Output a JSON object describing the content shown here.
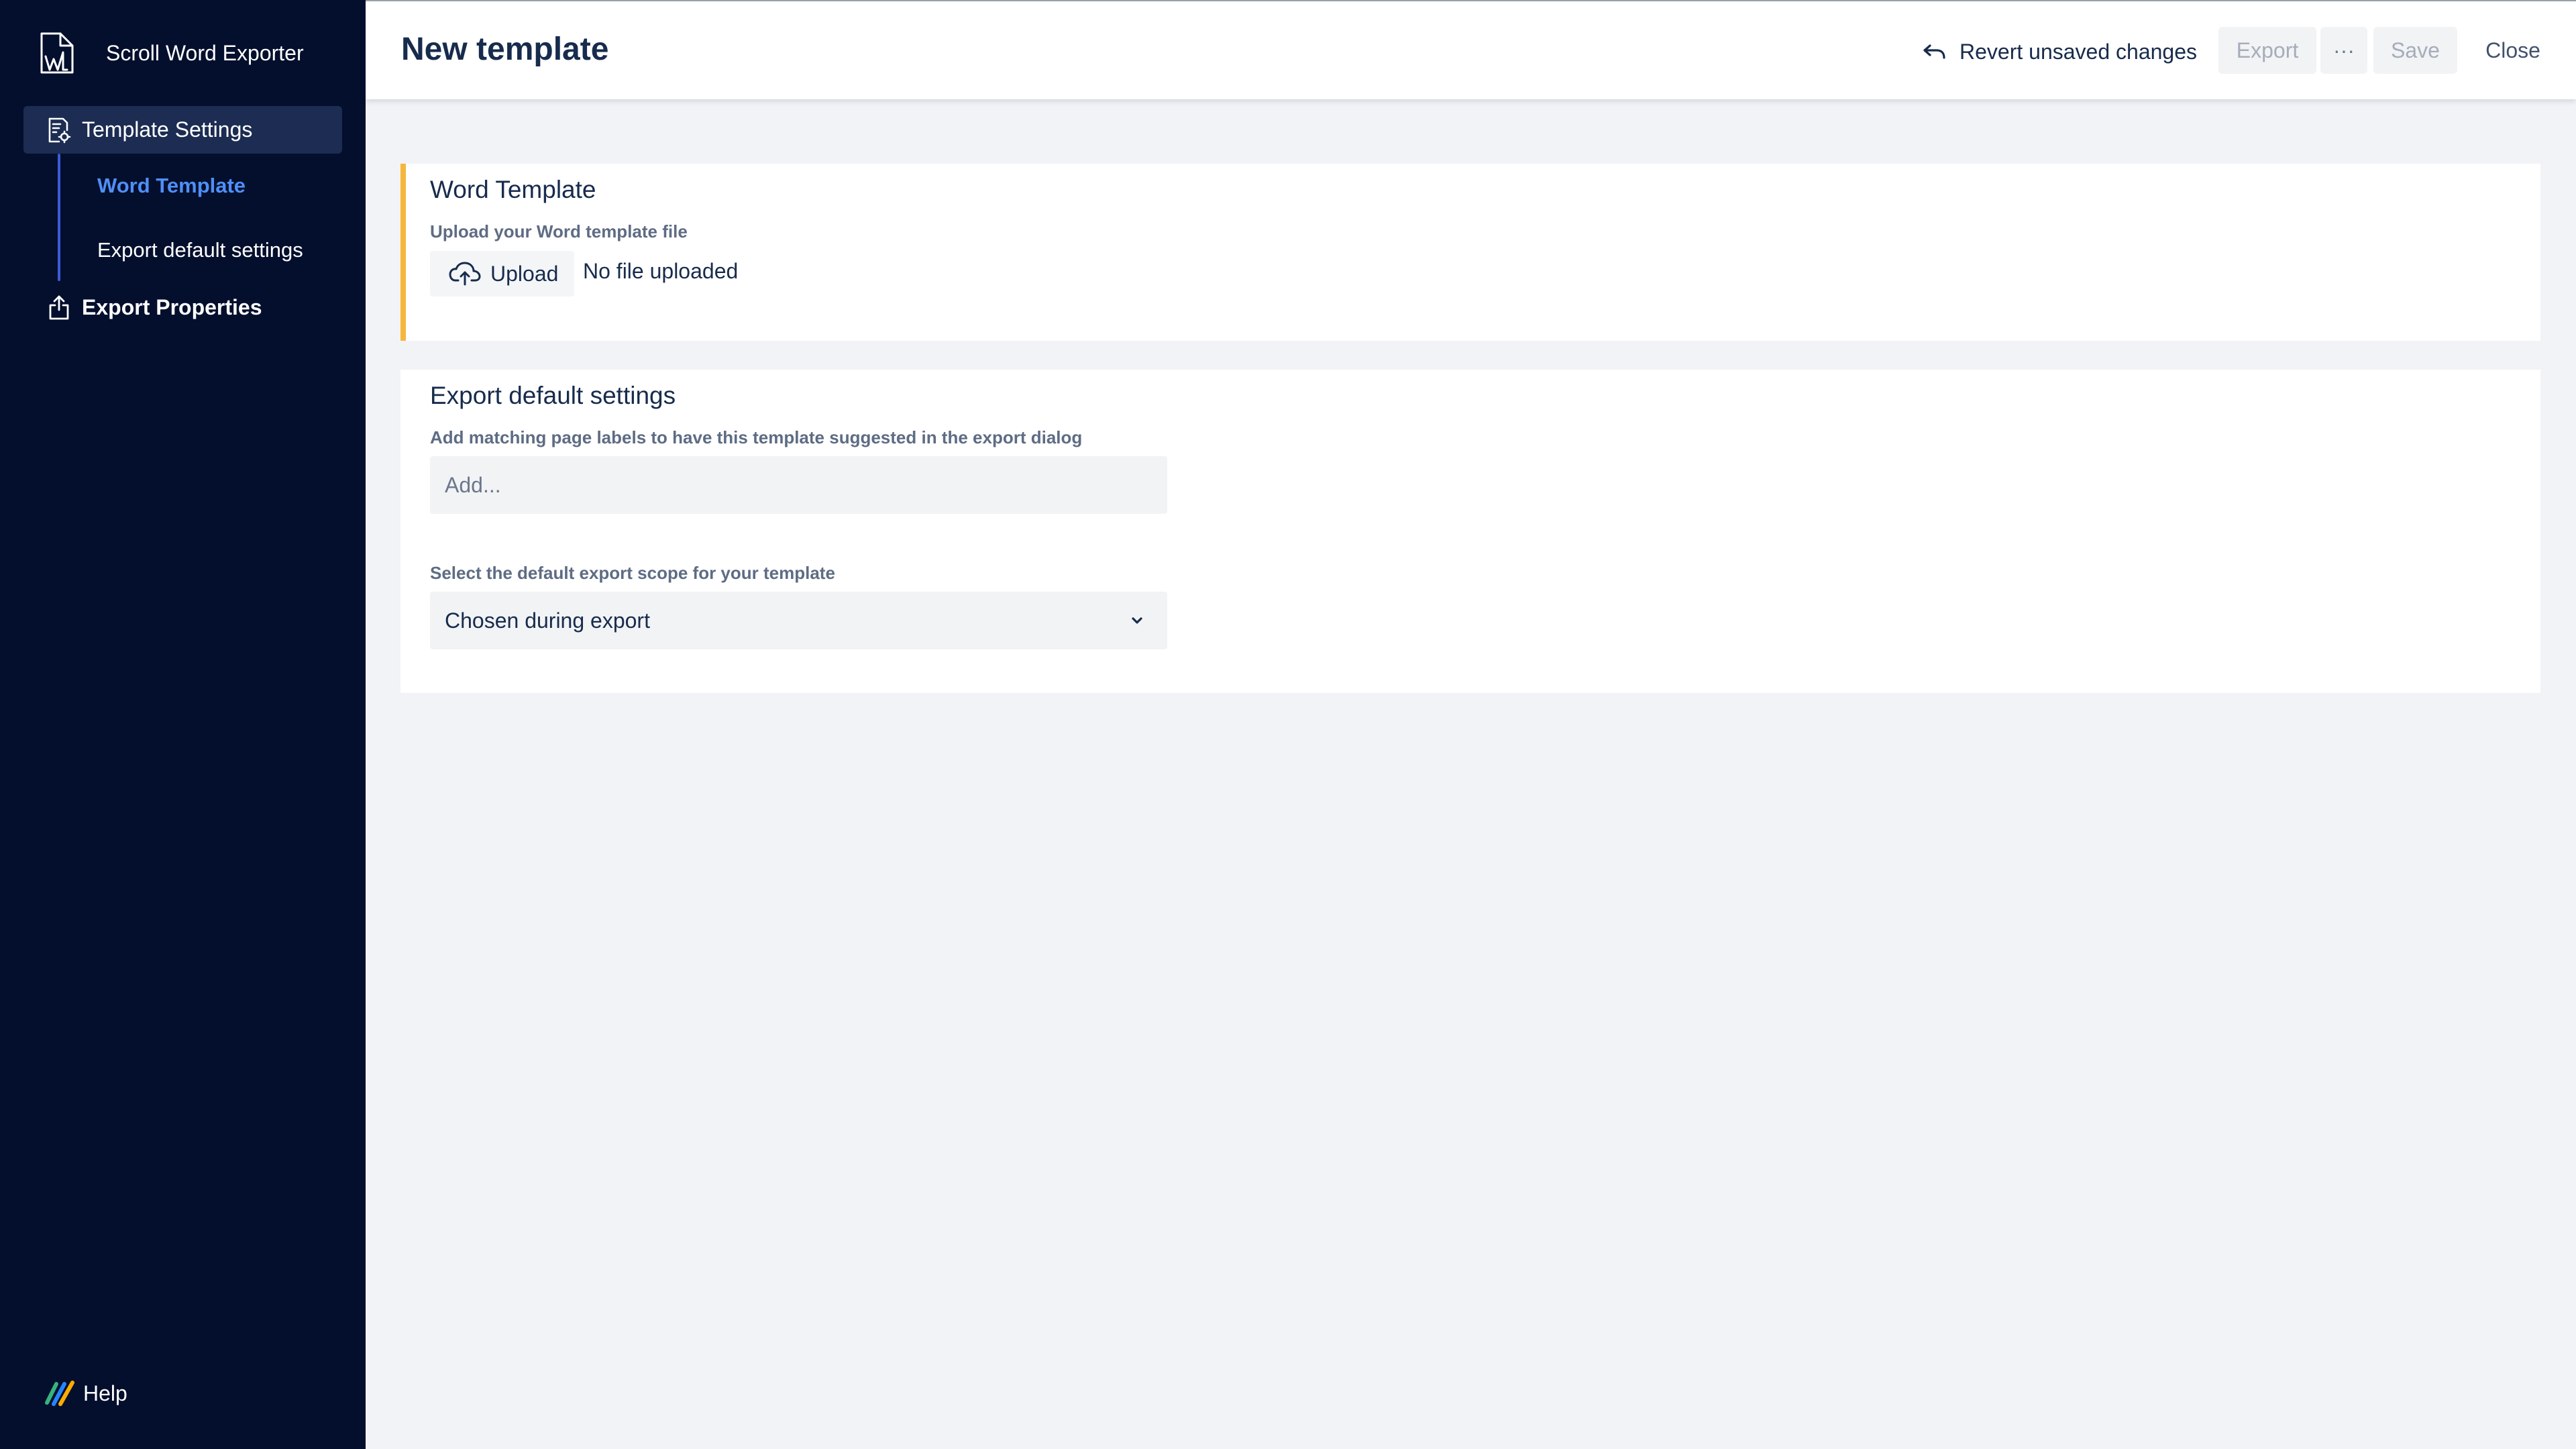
{
  "app": {
    "name": "Scroll Word Exporter",
    "logo_icon": "word-document-logo-icon"
  },
  "sidebar": {
    "items": [
      {
        "label": "Template Settings",
        "icon": "template-settings-icon",
        "active": true
      },
      {
        "label": "Word Template",
        "selected": true
      },
      {
        "label": "Export default settings"
      },
      {
        "label": "Export Properties",
        "icon": "export-properties-icon"
      }
    ],
    "help": {
      "label": "Help",
      "icon": "help-logo-icon"
    }
  },
  "header": {
    "title": "New template",
    "revert_label": "Revert unsaved changes",
    "revert_icon": "undo-icon",
    "export_label": "Export",
    "more_label": "···",
    "save_label": "Save",
    "close_label": "Close"
  },
  "word_template": {
    "title": "Word Template",
    "upload_label": "Upload your Word template file",
    "upload_button": "Upload",
    "upload_icon": "cloud-upload-icon",
    "status": "No file uploaded"
  },
  "export_defaults": {
    "title": "Export default settings",
    "labels_label": "Add matching page labels to have this template suggested in the export dialog",
    "labels_placeholder": "Add...",
    "scope_label": "Select the default export scope for your template",
    "scope_value": "Chosen during export",
    "scope_icon": "chevron-down-icon"
  },
  "colors": {
    "sidebar_bg": "#040f2d",
    "sidebar_active_bg": "#1c2c52",
    "selected_link": "#4f8ff7",
    "accent_border": "#f5b73b",
    "content_bg": "#f2f3f6"
  }
}
